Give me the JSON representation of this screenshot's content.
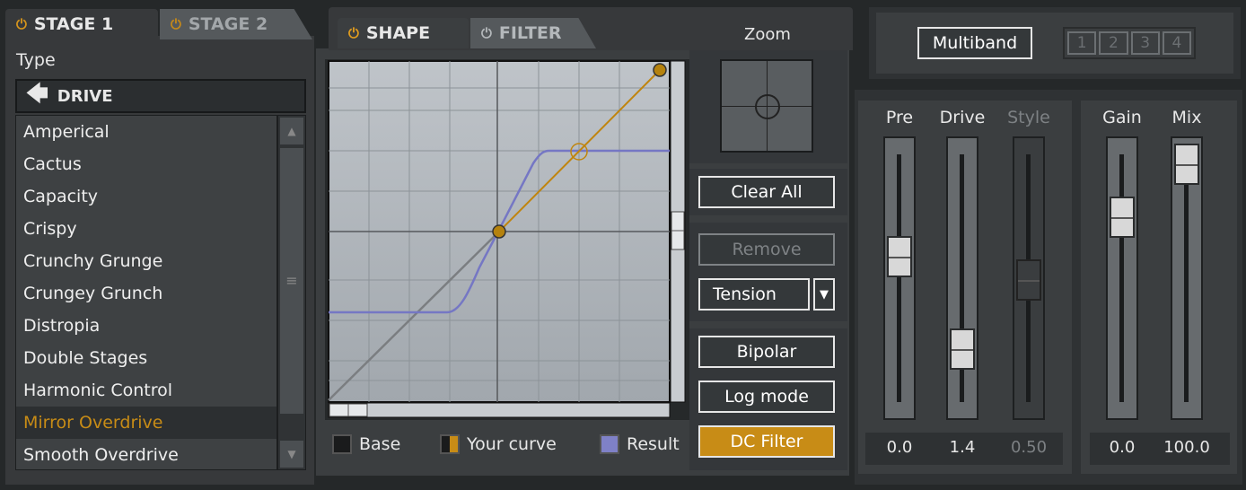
{
  "stage_tabs": [
    "STAGE 1",
    "STAGE 2"
  ],
  "type_label": "Type",
  "drive_button": "DRIVE",
  "presets": [
    "Amperical",
    "Cactus",
    "Capacity",
    "Crispy",
    "Crunchy Grunge",
    "Crungey Grunch",
    "Distropia",
    "Double Stages",
    "Harmonic Control",
    "Mirror Overdrive",
    "Smooth Overdrive"
  ],
  "selected_preset": "Mirror Overdrive",
  "editor_tabs": [
    "SHAPE",
    "FILTER"
  ],
  "zoom_label": "Zoom",
  "buttons": {
    "clear_all": "Clear All",
    "remove": "Remove",
    "tension": "Tension",
    "bipolar": "Bipolar",
    "log_mode": "Log mode",
    "dc_filter": "DC Filter",
    "multiband": "Multiband"
  },
  "band_buttons": [
    "1",
    "2",
    "3",
    "4"
  ],
  "legend": {
    "base": "Base",
    "your_curve": "Your curve",
    "result": "Result"
  },
  "faders": [
    {
      "label": "Pre",
      "value": "0.0",
      "level": 0.6
    },
    {
      "label": "Drive",
      "value": "1.4",
      "level": 0.2
    },
    {
      "label": "Style",
      "value": "0.50",
      "level": 0.5
    },
    {
      "label": "Gain",
      "value": "0.0",
      "level": 0.77
    },
    {
      "label": "Mix",
      "value": "100.0",
      "level": 1.0
    }
  ],
  "colors": {
    "accent": "#c88c16",
    "result": "#7f81c7",
    "panel": "#3b3e40",
    "plot_bg": "#b4bac0"
  }
}
